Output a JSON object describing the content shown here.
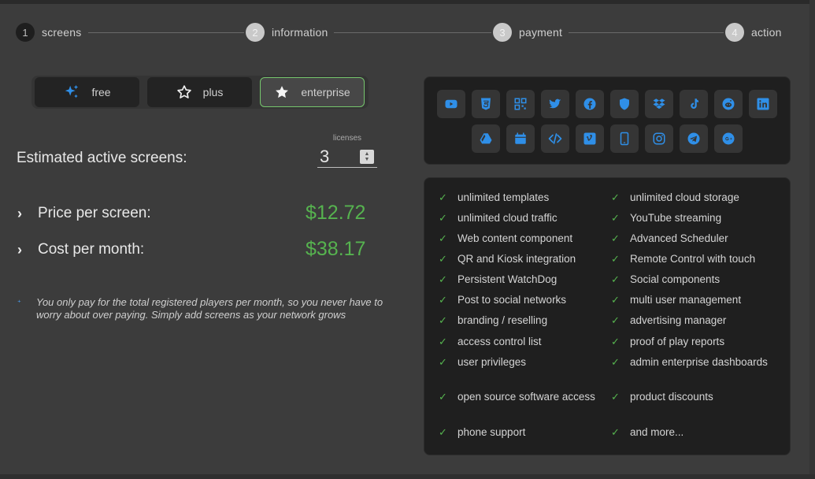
{
  "stepper": {
    "steps": [
      {
        "number": "1",
        "label": "screens"
      },
      {
        "number": "2",
        "label": "information"
      },
      {
        "number": "3",
        "label": "payment"
      },
      {
        "number": "4",
        "label": "action"
      }
    ]
  },
  "plans": [
    {
      "label": "free",
      "icon": "sparkles-icon"
    },
    {
      "label": "plus",
      "icon": "star-outline-icon"
    },
    {
      "label": "enterprise",
      "icon": "star-filled-icon",
      "selected": true
    }
  ],
  "screens": {
    "label": "Estimated active screens:",
    "licenses_label": "licenses",
    "value": "3"
  },
  "pricing": {
    "price_label": "Price per screen:",
    "price_value": "$12.72",
    "cost_label": "Cost per month:",
    "cost_value": "$38.17"
  },
  "note": "You only pay for the total registered players per month, so you never have to worry about over paying. Simply add screens as your network grows",
  "social_icons": [
    "youtube-icon",
    "html5-icon",
    "qr-code-icon",
    "twitter-icon",
    "facebook-icon",
    "shield-icon",
    "dropbox-icon",
    "tiktok-icon",
    "reddit-icon",
    "linkedin-icon",
    "google-drive-icon",
    "calendar-icon",
    "code-icon",
    "vimeo-icon",
    "mobile-icon",
    "instagram-icon",
    "telegram-icon",
    "google-plus-icon"
  ],
  "features": {
    "left": [
      "unlimited templates",
      "unlimited cloud traffic",
      "Web content component",
      "QR and Kiosk integration",
      "Persistent WatchDog",
      "Post to social networks",
      "branding / reselling",
      "access control list",
      "user privileges",
      "open source software access",
      "phone support"
    ],
    "right": [
      "unlimited cloud storage",
      "YouTube streaming",
      "Advanced Scheduler",
      "Remote Control with touch",
      "Social components",
      "multi user management",
      "advertising manager",
      "proof of play reports",
      "admin enterprise dashboards",
      "product discounts",
      "and more..."
    ]
  },
  "colors": {
    "accent_green": "#56b34f",
    "icon_blue": "#2f8fe8",
    "background": "#3c3c3c",
    "panel": "#1f1f1f"
  }
}
